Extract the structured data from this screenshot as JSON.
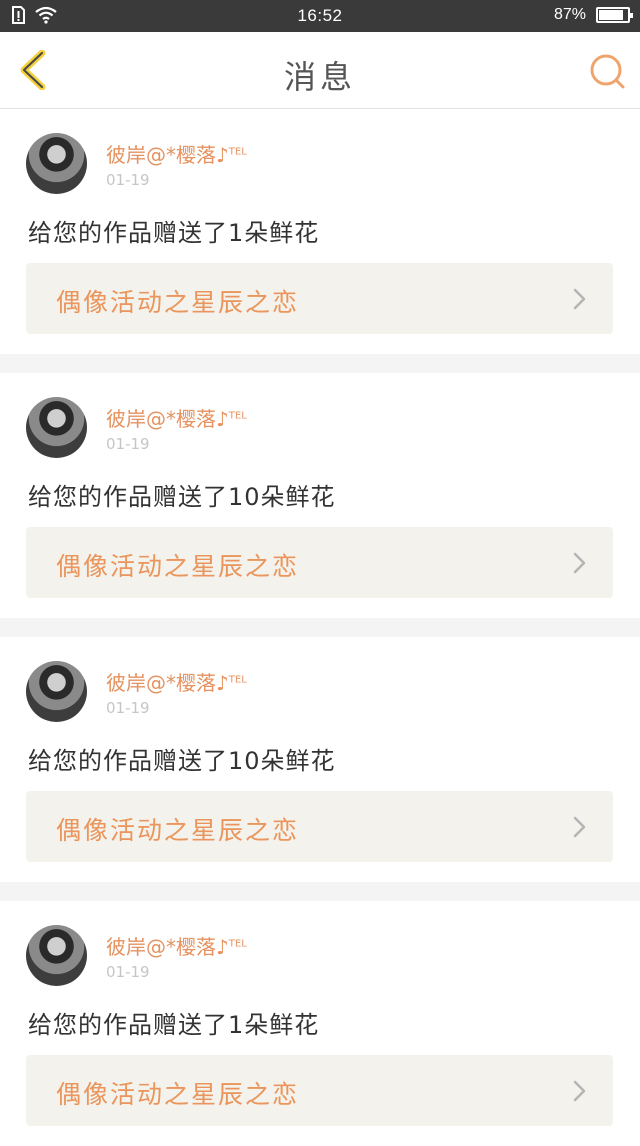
{
  "status_bar": {
    "time": "16:52",
    "battery_text": "87%",
    "battery_level": 0.87
  },
  "header": {
    "title": "消息"
  },
  "colors": {
    "accent": "#ea955b",
    "username": "#e59260",
    "card_bg": "#ffffff",
    "activity_bg": "#f3f2ec",
    "status_bar_bg": "#3a3a3a"
  },
  "messages": [
    {
      "username": "彼岸@*樱落♪",
      "username_sup": "TEL",
      "date": "01-19",
      "text": "给您的作品赠送了1朵鲜花",
      "activity": "偶像活动之星辰之恋"
    },
    {
      "username": "彼岸@*樱落♪",
      "username_sup": "TEL",
      "date": "01-19",
      "text": "给您的作品赠送了10朵鲜花",
      "activity": "偶像活动之星辰之恋"
    },
    {
      "username": "彼岸@*樱落♪",
      "username_sup": "TEL",
      "date": "01-19",
      "text": "给您的作品赠送了10朵鲜花",
      "activity": "偶像活动之星辰之恋"
    },
    {
      "username": "彼岸@*樱落♪",
      "username_sup": "TEL",
      "date": "01-19",
      "text": "给您的作品赠送了1朵鲜花",
      "activity": "偶像活动之星辰之恋"
    }
  ]
}
